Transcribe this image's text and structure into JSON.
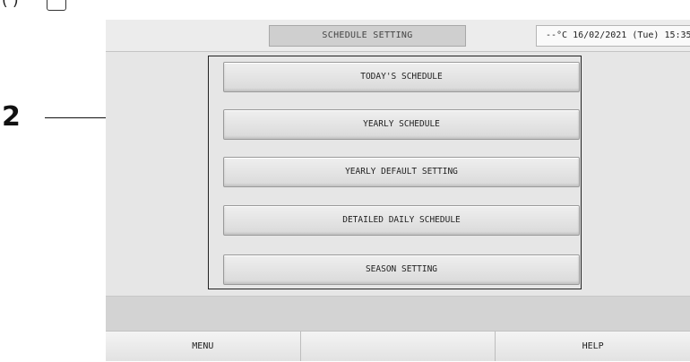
{
  "caption": {
    "text": "(          )"
  },
  "callout": {
    "number": "2"
  },
  "header": {
    "title": "SCHEDULE SETTING",
    "status": "--°C  16/02/2021 (Tue) 15:35"
  },
  "menu": {
    "items": [
      {
        "label": "TODAY'S SCHEDULE"
      },
      {
        "label": "YEARLY SCHEDULE"
      },
      {
        "label": "YEARLY DEFAULT SETTING"
      },
      {
        "label": "DETAILED DAILY SCHEDULE"
      },
      {
        "label": "SEASON SETTING"
      }
    ]
  },
  "footer": {
    "menu_label": "MENU",
    "middle_label": "",
    "help_label": "HELP"
  }
}
